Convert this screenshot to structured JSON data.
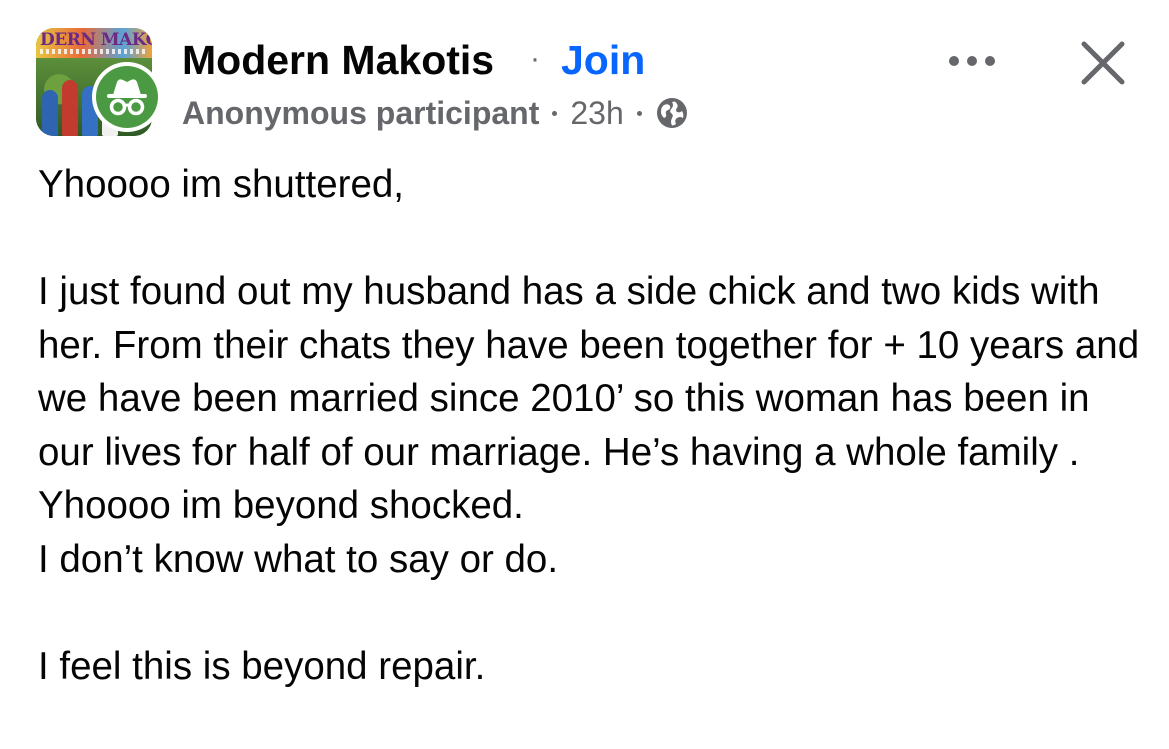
{
  "group": {
    "name": "Modern Makotis",
    "join_label": "Join",
    "avatar_text": "DERN MAKO"
  },
  "author": {
    "name": "Anonymous participant",
    "time": "23h",
    "audience_icon": "globe-icon"
  },
  "actions": {
    "more_icon": "more-horizontal-icon",
    "close_icon": "close-icon"
  },
  "post": {
    "lines": [
      "Yhoooo im shuttered,",
      "",
      "I just found out my husband has a side chick and two kids with her. From their chats they have been together for + 10 years and we have been married since 2010’ so this woman has been in our lives for half of our marriage. He’s having a whole family .\nYhoooo im beyond shocked.\nI don’t know what to say or do.",
      "",
      "I feel this is beyond repair."
    ]
  },
  "colors": {
    "text": "#050505",
    "secondary": "#65676b",
    "link": "#0866ff",
    "anon_badge": "#4b9a43"
  }
}
